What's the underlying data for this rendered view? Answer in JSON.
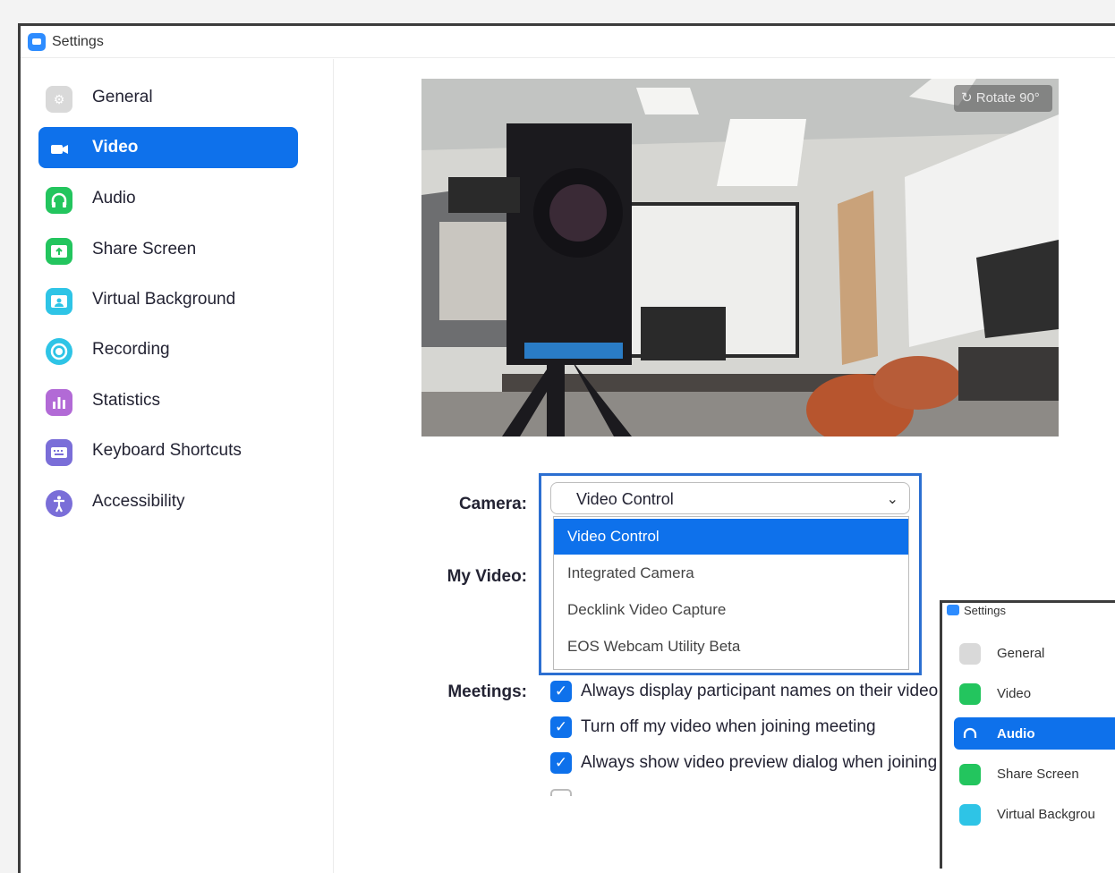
{
  "window": {
    "title": "Settings"
  },
  "sidebar": {
    "items": [
      {
        "label": "General",
        "icon": "gear-icon",
        "color": "#d9d9d9",
        "glyph": "⚙",
        "active": false
      },
      {
        "label": "Video",
        "icon": "video-camera-icon",
        "color": "#ffffff",
        "glyph": "■",
        "active": true
      },
      {
        "label": "Audio",
        "icon": "headphones-icon",
        "color": "#23c55e",
        "glyph": "∩",
        "active": false
      },
      {
        "label": "Share Screen",
        "icon": "share-screen-icon",
        "color": "#23c55e",
        "glyph": "↑",
        "active": false
      },
      {
        "label": "Virtual Background",
        "icon": "virtual-background-icon",
        "color": "#2ec4e6",
        "glyph": "☺",
        "active": false
      },
      {
        "label": "Recording",
        "icon": "recording-icon",
        "color": "#2ec4e6",
        "glyph": "◉",
        "active": false
      },
      {
        "label": "Statistics",
        "icon": "statistics-icon",
        "color": "#b26ad6",
        "glyph": "▮",
        "active": false
      },
      {
        "label": "Keyboard Shortcuts",
        "icon": "keyboard-icon",
        "color": "#7a6ed8",
        "glyph": "⌨",
        "active": false
      },
      {
        "label": "Accessibility",
        "icon": "accessibility-icon",
        "color": "#7a6ed8",
        "glyph": "†",
        "active": false
      }
    ]
  },
  "preview": {
    "rotate_label": "Rotate 90°"
  },
  "camera": {
    "label": "Camera:",
    "selected": "Video Control",
    "options": [
      "Video Control",
      "Integrated Camera",
      "Decklink Video Capture",
      "EOS Webcam Utility Beta"
    ]
  },
  "my_video": {
    "label": "My Video:"
  },
  "meetings": {
    "label": "Meetings:",
    "checkboxes": [
      {
        "label": "Always display participant names on their video",
        "checked": true
      },
      {
        "label": "Turn off my video when joining meeting",
        "checked": true
      },
      {
        "label": "Always show video preview dialog when joining a v",
        "checked": true
      },
      {
        "label": "",
        "checked": false
      }
    ]
  },
  "inset": {
    "title": "Settings",
    "items": [
      {
        "label": "General",
        "icon": "gear-icon",
        "color": "#d9d9d9",
        "active": false
      },
      {
        "label": "Video",
        "icon": "video-camera-icon",
        "color": "#23c55e",
        "active": false
      },
      {
        "label": "Audio",
        "icon": "headphones-icon",
        "color": "#ffffff",
        "active": true
      },
      {
        "label": "Share Screen",
        "icon": "share-screen-icon",
        "color": "#23c55e",
        "active": false
      },
      {
        "label": "Virtual Backgrou",
        "icon": "virtual-background-icon",
        "color": "#2ec4e6",
        "active": false
      }
    ]
  },
  "colors": {
    "accent": "#0e71eb",
    "highlight_border": "#2c6fd1"
  }
}
